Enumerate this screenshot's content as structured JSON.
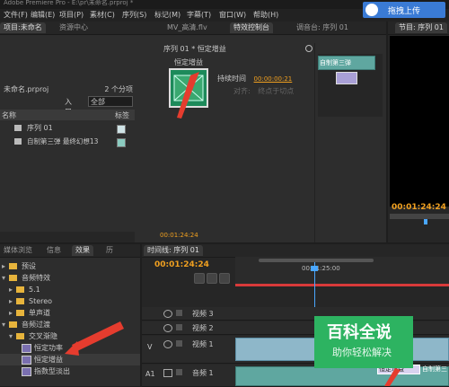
{
  "app": {
    "title": "Adobe Premiere Pro - E:\\pr\\未命名.prproj *"
  },
  "menu": {
    "items": [
      "文件(F)",
      "编辑(E)",
      "项目(P)",
      "素材(C)",
      "序列(S)",
      "标记(M)",
      "字幕(T)",
      "窗口(W)",
      "帮助(H)"
    ]
  },
  "upload": {
    "label": "拖拽上传"
  },
  "project_panel": {
    "tabs": [
      "项目:未命名",
      "资源中心"
    ],
    "project_name": "未命名.prproj",
    "item_count": "2 个分项",
    "entry_label": "入口:",
    "entry_value": "全部",
    "col_name": "名称",
    "col_label": "标签",
    "items": [
      {
        "name": "序列 01"
      },
      {
        "name": "自制第三弹 最终幻想13"
      }
    ]
  },
  "effect_controls": {
    "tabs": [
      "MV_高清.flv",
      "特效控制台",
      "调音台: 序列 01"
    ],
    "header": "序列 01 * 恒定增益",
    "effect_name": "恒定增益",
    "duration_label": "持续时间",
    "duration_value": "00:00:00:21",
    "align_label": "对齐:",
    "align_value": "终点于切点",
    "clip_label": "自制第三弹",
    "bottom_timecode": "00:01:24:24"
  },
  "program_monitor": {
    "title": "节目: 序列 01",
    "timecode": "00:01:24:24"
  },
  "effects_panel": {
    "tabs": [
      "媒体浏览",
      "信息",
      "效果",
      "历"
    ],
    "tree": [
      {
        "label": "预设",
        "indent": 0
      },
      {
        "label": "音频特效",
        "indent": 0
      },
      {
        "label": "5.1",
        "indent": 1
      },
      {
        "label": "Stereo",
        "indent": 1
      },
      {
        "label": "单声道",
        "indent": 1
      },
      {
        "label": "音频过渡",
        "indent": 0
      },
      {
        "label": "交叉渐隐",
        "indent": 1
      },
      {
        "label": "恒定功率",
        "indent": 2
      },
      {
        "label": "恒定增益",
        "indent": 2
      },
      {
        "label": "指数型淡出",
        "indent": 2
      }
    ]
  },
  "timeline": {
    "tab": "时间线: 序列 01",
    "timecode": "00:01:24:24",
    "ruler_time": "00:01:25:00",
    "tracks": [
      {
        "name": "视频 3",
        "side": ""
      },
      {
        "name": "视频 2",
        "side": ""
      },
      {
        "name": "视频 1",
        "side": "V"
      },
      {
        "name": "音频 1",
        "side": "A1"
      }
    ],
    "audio_transition_label": "恒定增益",
    "clip_label": "自制第三"
  },
  "watermark": {
    "title": "百科全说",
    "subtitle": "助你轻松解决"
  },
  "colors": {
    "timecode": "#f0a020",
    "arrow": "#e53c2e",
    "watermark_bg": "#2db361",
    "video_clip": "#8eb7c9",
    "audio_clip": "#5fa7a0"
  }
}
